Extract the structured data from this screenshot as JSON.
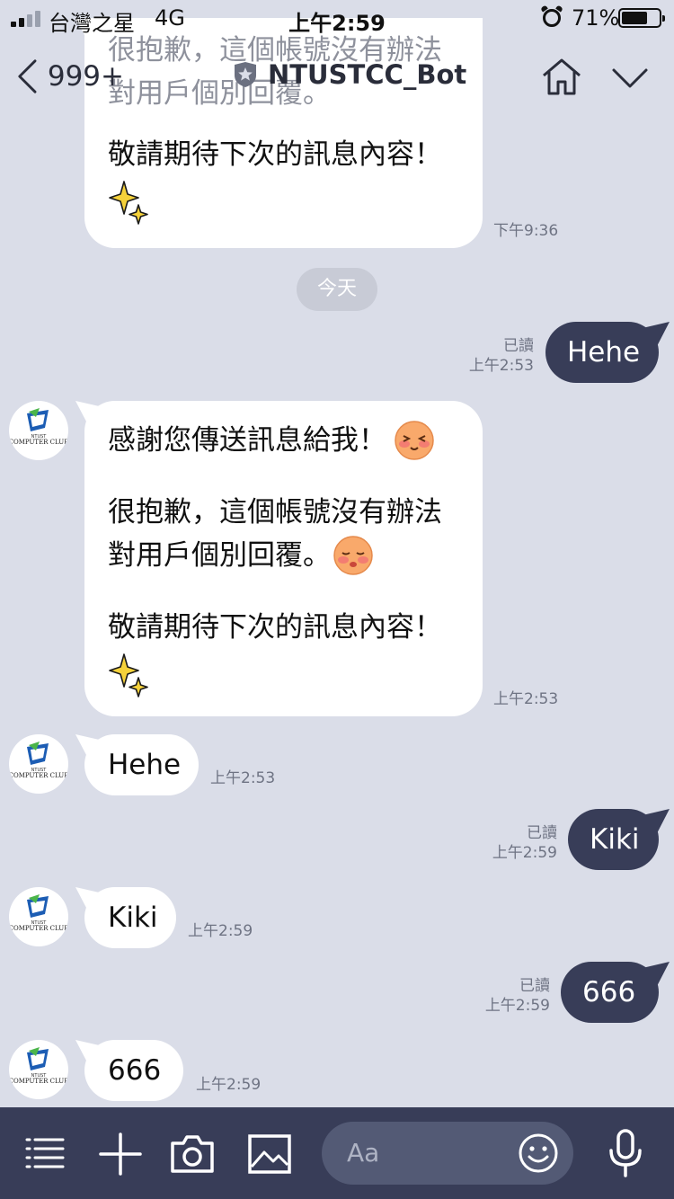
{
  "status_bar": {
    "carrier": "台灣之星",
    "network": "4G",
    "time": "上午2:59",
    "battery_percent": "71%",
    "battery_level": 0.71,
    "signal_bars_active": 2,
    "signal_bars_total": 4
  },
  "nav": {
    "back_label": "999+",
    "title": "NTUSTCC_Bot",
    "icons": [
      "chevron-left-icon",
      "star-badge-icon",
      "home-icon",
      "chevron-down-icon"
    ]
  },
  "messages": {
    "top_partial": {
      "line1": "很抱歉，這個帳號沒有辦法",
      "line2": "對用戶個別回覆。",
      "line3": "敬請期待下次的訊息內容！",
      "time": "下午9:36"
    },
    "day_separator": "今天",
    "out_1": {
      "text": "Hehe",
      "read": "已讀",
      "time": "上午2:53"
    },
    "auto_reply": {
      "line1": "感謝您傳送訊息給我！",
      "line2": "很抱歉，這個帳號沒有辦法",
      "line3": "對用戶個別回覆。",
      "line4": "敬請期待下次的訊息內容！",
      "time": "上午2:53"
    },
    "in_1": {
      "text": "Hehe",
      "time": "上午2:53"
    },
    "out_2": {
      "text": "Kiki",
      "read": "已讀",
      "time": "上午2:59"
    },
    "in_2": {
      "text": "Kiki",
      "time": "上午2:59"
    },
    "out_3": {
      "text": "666",
      "read": "已讀",
      "time": "上午2:59"
    },
    "in_3": {
      "text": "666",
      "time": "上午2:59"
    }
  },
  "avatar": {
    "name": "NTUST COMPUTER CLUB",
    "logo_top": "NTUST",
    "logo_text": "COMPUTER CLUB"
  },
  "bottom_bar": {
    "input_placeholder": "Aa",
    "icons": [
      "menu-icon",
      "plus-icon",
      "camera-icon",
      "image-icon",
      "smiley-icon",
      "microphone-icon"
    ]
  },
  "colors": {
    "background": "#dadde8",
    "outgoing_bubble": "#383d58",
    "incoming_bubble": "#ffffff",
    "bottom_bar": "#383d58",
    "text_secondary": "#6e7383"
  }
}
